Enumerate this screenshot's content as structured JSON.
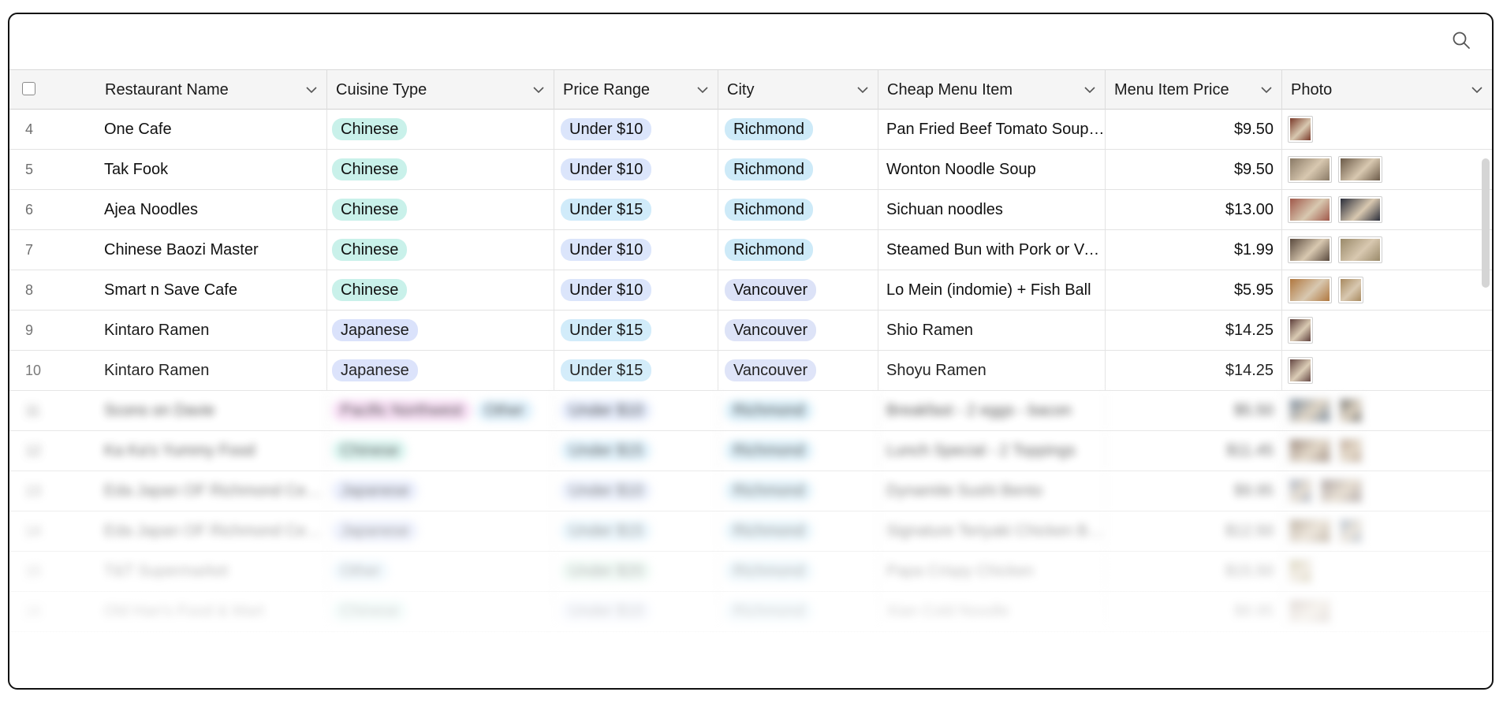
{
  "columns": {
    "restaurant": "Restaurant Name",
    "cuisine": "Cuisine Type",
    "price_range": "Price Range",
    "city": "City",
    "menu_item": "Cheap Menu Item",
    "menu_price": "Menu Item Price",
    "photo": "Photo"
  },
  "colors": {
    "chinese": "#c9f1ea",
    "japanese": "#d9e1fb",
    "pacific_northwest": "#f6d3f2",
    "other": "#d4ecfb",
    "under_10": "#dbe5fb",
    "under_15": "#d0ebfa",
    "under_20": "#cfeee0",
    "richmond": "#cdeaf8",
    "vancouver": "#dce2f7"
  },
  "rows": [
    {
      "id": "4",
      "name": "One Cafe",
      "cuisine": [
        "Chinese"
      ],
      "price": "Under $10",
      "city": "Richmond",
      "item": "Pan Fried Beef Tomato Soup with Rice",
      "amount": "$9.50",
      "photos": [
        [
          "n",
          "#7a3a2a"
        ]
      ]
    },
    {
      "id": "5",
      "name": "Tak Fook",
      "cuisine": [
        "Chinese"
      ],
      "price": "Under $10",
      "city": "Richmond",
      "item": "Wonton Noodle Soup",
      "amount": "$9.50",
      "photos": [
        [
          "w",
          "#8a7a66"
        ],
        [
          "w",
          "#6b5a48"
        ]
      ]
    },
    {
      "id": "6",
      "name": "Ajea Noodles",
      "cuisine": [
        "Chinese"
      ],
      "price": "Under $15",
      "city": "Richmond",
      "item": "Sichuan noodles",
      "amount": "$13.00",
      "photos": [
        [
          "w",
          "#a0584a"
        ],
        [
          "w",
          "#2b2e3a"
        ]
      ]
    },
    {
      "id": "7",
      "name": "Chinese Baozi Master",
      "cuisine": [
        "Chinese"
      ],
      "price": "Under $10",
      "city": "Richmond",
      "item": "Steamed Bun with Pork or Vegetables",
      "amount": "$1.99",
      "photos": [
        [
          "w",
          "#5a4a3e"
        ],
        [
          "w",
          "#9a8a6a"
        ]
      ]
    },
    {
      "id": "8",
      "name": "Smart n Save Cafe",
      "cuisine": [
        "Chinese"
      ],
      "price": "Under $10",
      "city": "Vancouver",
      "item": "Lo Mein (indomie) + Fish Ball",
      "amount": "$5.95",
      "photos": [
        [
          "w",
          "#b07840"
        ],
        [
          "n",
          "#a88a60"
        ]
      ]
    },
    {
      "id": "9",
      "name": "Kintaro Ramen",
      "cuisine": [
        "Japanese"
      ],
      "price": "Under $15",
      "city": "Vancouver",
      "item": "Shio Ramen",
      "amount": "$14.25",
      "photos": [
        [
          "n",
          "#5a3a36"
        ]
      ]
    },
    {
      "id": "10",
      "name": "Kintaro Ramen",
      "cuisine": [
        "Japanese"
      ],
      "price": "Under $15",
      "city": "Vancouver",
      "item": "Shoyu Ramen",
      "amount": "$14.25",
      "photos": [
        [
          "n",
          "#5a3a36"
        ]
      ]
    },
    {
      "id": "11",
      "name": "Scons on Davie",
      "cuisine": [
        "Pacific Northwest",
        "Other"
      ],
      "price": "Under $10",
      "city": "Richmond",
      "item": "Breakfast - 2 eggs - bacon",
      "amount": "$5.50",
      "photos": [
        [
          "w",
          "#3e5670"
        ],
        [
          "n",
          "#2a2a26"
        ]
      ],
      "blur": true
    },
    {
      "id": "12",
      "name": "Ka Ka's Yummy Food",
      "cuisine": [
        "Chinese"
      ],
      "price": "Under $15",
      "city": "Richmond",
      "item": "Lunch Special - 2 Toppings",
      "amount": "$11.45",
      "photos": [
        [
          "w",
          "#6a5040"
        ],
        [
          "n",
          "#9a7a60"
        ]
      ],
      "blur": true
    },
    {
      "id": "13",
      "name": "Eda Japan OF Richmond Centre",
      "cuisine": [
        "Japanese"
      ],
      "price": "Under $10",
      "city": "Richmond",
      "item": "Dynamite Sushi Bento",
      "amount": "$9.95",
      "photos": [
        [
          "n",
          "#5a6a8a"
        ],
        [
          "w",
          "#6a5a5a"
        ]
      ],
      "blur": true
    },
    {
      "id": "14",
      "name": "Eda Japan OF Richmond Centre",
      "cuisine": [
        "Japanese"
      ],
      "price": "Under $15",
      "city": "Richmond",
      "item": "Signature Teriyaki Chicken Bowl",
      "amount": "$12.50",
      "photos": [
        [
          "w",
          "#6a5030"
        ],
        [
          "n",
          "#506a8a"
        ]
      ],
      "blur": true
    },
    {
      "id": "15",
      "name": "T&T Supermarket",
      "cuisine": [
        "Other"
      ],
      "price": "Under $20",
      "city": "Richmond",
      "item": "Papa Crispy Chicken",
      "amount": "$15.50",
      "photos": [
        [
          "n",
          "#8a7a30"
        ]
      ],
      "blur": true
    },
    {
      "id": "16",
      "name": "Old Han's Food & Mart",
      "cuisine": [
        "Chinese"
      ],
      "price": "Under $10",
      "city": "Richmond",
      "item": "Xian Cold Noodle",
      "amount": "$8.95",
      "photos": [
        [
          "w",
          "#6a4a3a"
        ]
      ],
      "blur": true
    }
  ]
}
